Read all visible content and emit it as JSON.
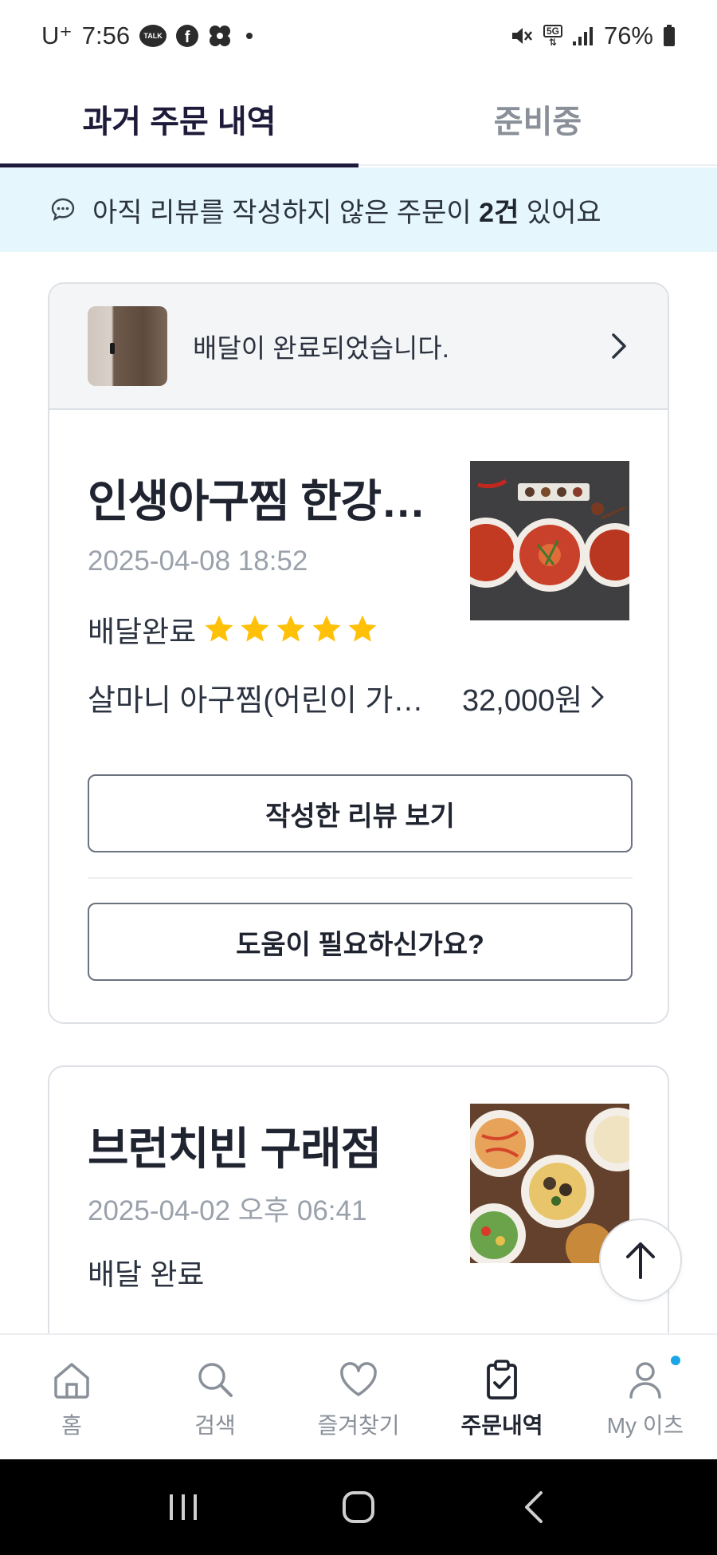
{
  "status_bar": {
    "carrier": "U⁺",
    "time": "7:56",
    "talk_icon_text": "TALK",
    "network": "5G",
    "battery": "76%"
  },
  "tabs": [
    {
      "label": "과거 주문 내역",
      "active": true
    },
    {
      "label": "준비중",
      "active": false
    }
  ],
  "review_banner": {
    "prefix": "아직 리뷰를 작성하지 않은 주문이 ",
    "count": "2건",
    "suffix": " 있어요"
  },
  "orders": [
    {
      "delivery_message": "배달이 완료되었습니다.",
      "store_name": "인생아구찜 한강…",
      "date": "2025-04-08 18:52",
      "status": "배달완료",
      "rating": 5,
      "menu": "살마니 아구찜(어린이 가…",
      "price": "32,000원",
      "review_button": "작성한 리뷰 보기",
      "help_button": "도움이 필요하신가요?"
    },
    {
      "store_name": "브런치빈 구래점",
      "date": "2025-04-02 오후 06:41",
      "status": "배달 완료"
    }
  ],
  "bottom_nav": [
    {
      "label": "홈",
      "icon": "home-icon"
    },
    {
      "label": "검색",
      "icon": "search-icon"
    },
    {
      "label": "즐겨찾기",
      "icon": "heart-icon"
    },
    {
      "label": "주문내역",
      "icon": "clipboard-check-icon",
      "active": true
    },
    {
      "label": "My 이츠",
      "icon": "user-icon",
      "has_dot": true
    }
  ],
  "colors": {
    "accent": "#1e1b3a",
    "banner_bg": "#e5f6fd",
    "star": "#ffc107",
    "notification_dot": "#1aa6e6"
  }
}
